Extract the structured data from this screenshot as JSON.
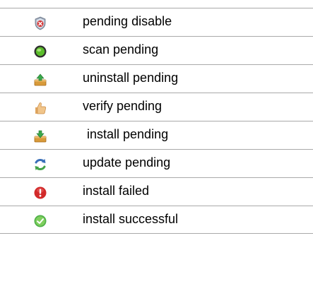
{
  "legend": {
    "items": [
      {
        "icon": "shield-x-icon",
        "label": "pending disable"
      },
      {
        "icon": "green-dot-icon",
        "label": "scan pending"
      },
      {
        "icon": "uninstall-box-icon",
        "label": "uninstall pending"
      },
      {
        "icon": "thumbs-up-icon",
        "label": "verify pending"
      },
      {
        "icon": "install-box-icon",
        "label": " install pending"
      },
      {
        "icon": "refresh-arrows-icon",
        "label": "update pending"
      },
      {
        "icon": "error-exclamation-icon",
        "label": "install failed"
      },
      {
        "icon": "check-circle-icon",
        "label": "install successful"
      }
    ]
  }
}
